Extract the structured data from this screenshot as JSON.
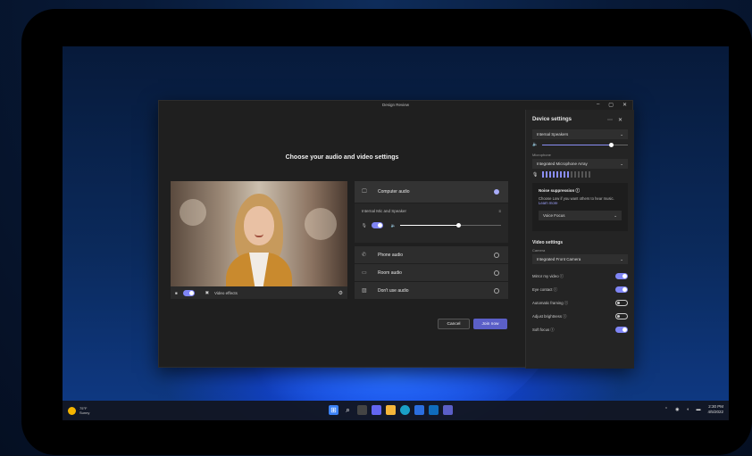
{
  "window": {
    "title": "Design Review",
    "controls": [
      "–",
      "▢",
      "✕"
    ]
  },
  "main": {
    "heading": "Choose your audio and video settings"
  },
  "video_controls": {
    "effects_label": "Video effects"
  },
  "audio": {
    "computer_audio": "Computer audio",
    "device_label": "Internal Mic and Speaker",
    "phone_audio": "Phone audio",
    "room_audio": "Room audio",
    "dont_use_audio": "Don't use audio",
    "volume_level": 0.57
  },
  "buttons": {
    "cancel": "Cancel",
    "join": "Join now"
  },
  "device_settings": {
    "title": "Device settings",
    "speaker": "Internal Speakers",
    "speaker_volume": 0.8,
    "microphone_label": "Microphone",
    "microphone": "Integrated Microphone Array",
    "mic_level_bars": 8,
    "mic_total_bars": 14,
    "noise_title": "Noise suppression",
    "noise_desc": "Choose Low if you want others to hear music.",
    "noise_learn_more": "Learn more",
    "noise_option": "Voice Focus",
    "video_title": "Video settings",
    "camera_label": "Camera",
    "camera": "Integrated Front Camera",
    "toggles": [
      {
        "label": "Mirror my video",
        "on": true
      },
      {
        "label": "Eye contact",
        "on": true
      },
      {
        "label": "Automatic framing",
        "on": false
      },
      {
        "label": "Adjust brightness",
        "on": false
      },
      {
        "label": "Soft focus",
        "on": true
      }
    ]
  },
  "taskbar": {
    "weather_temp": "75°F",
    "weather_cond": "Sunny",
    "time": "2:30 PM",
    "date": "4/5/2022"
  },
  "colors": {
    "accent": "#7f85f5",
    "join_button": "#5b5fc7"
  }
}
